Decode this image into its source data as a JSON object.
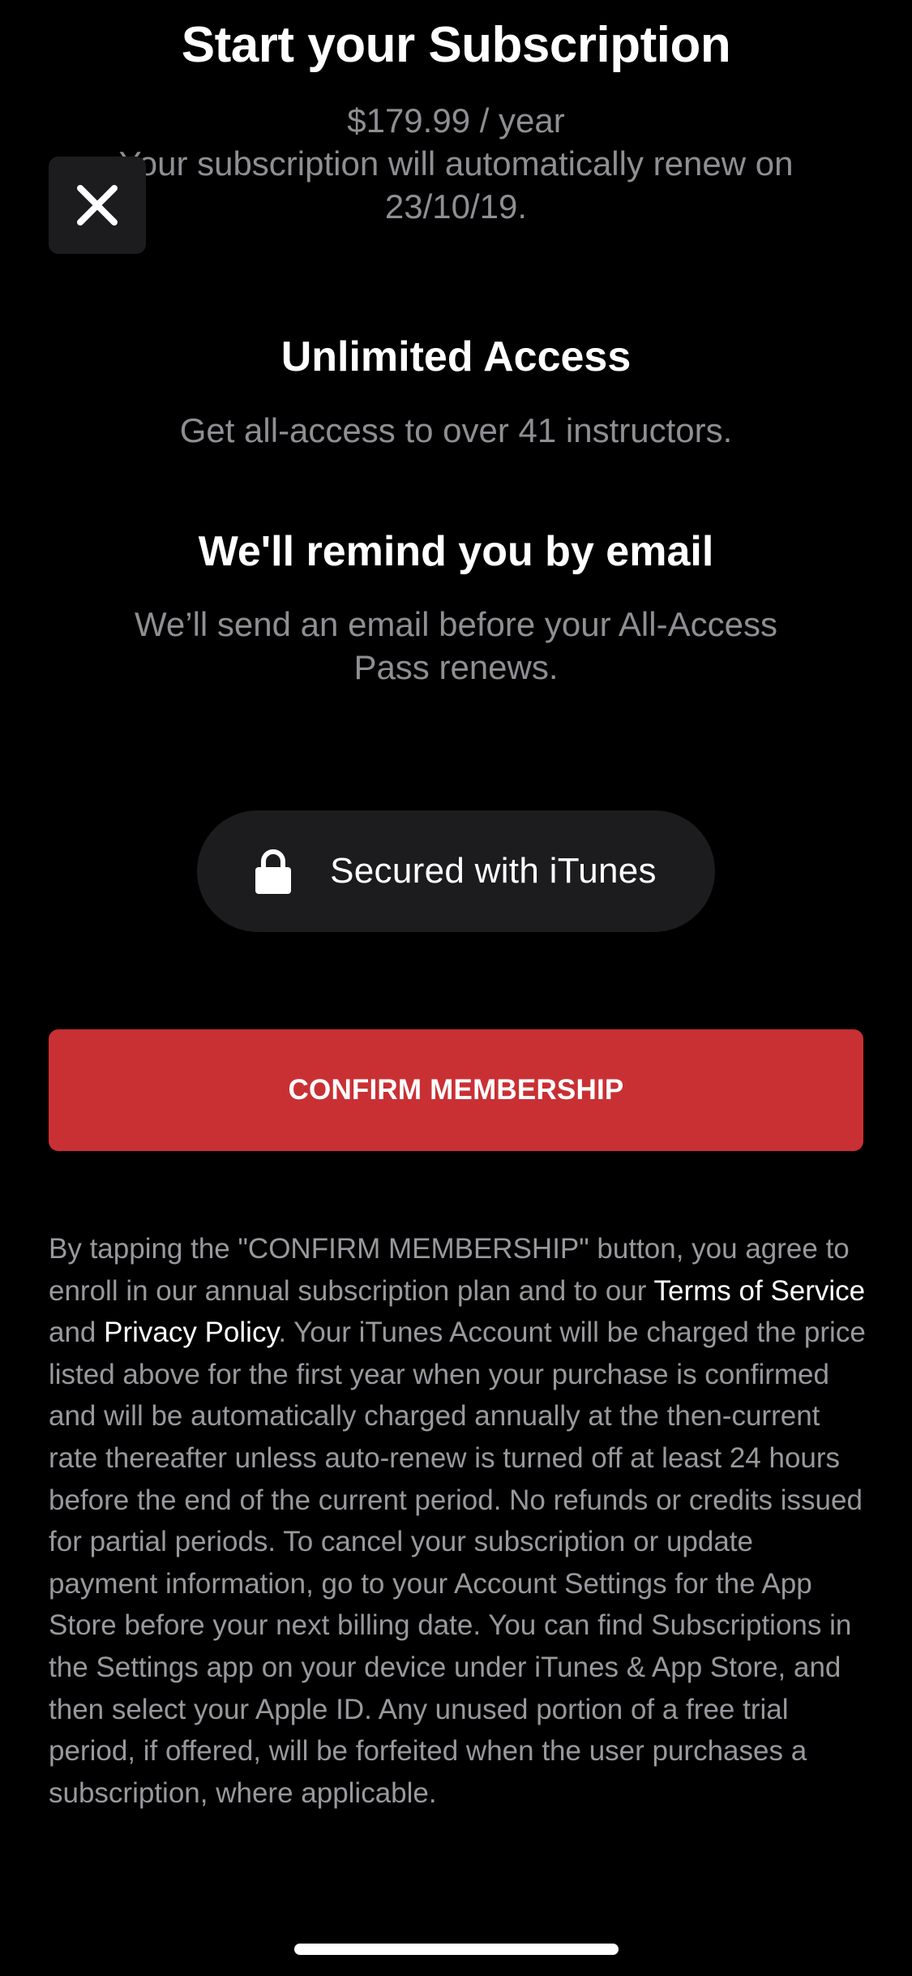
{
  "header": {
    "title": "Start your Subscription",
    "price": "$179.99 / year",
    "renewal_line1": "Your subscription will automatically renew on",
    "renewal_line2": "23/10/19."
  },
  "icons": {
    "close": "close-icon",
    "lock": "lock-icon"
  },
  "features": [
    {
      "heading": "Unlimited Access",
      "text": "Get all-access to over 41 instructors."
    },
    {
      "heading": "We'll remind you by email",
      "text_line1": "We’ll send an email before your All-Access",
      "text_line2": "Pass renews."
    }
  ],
  "secured": {
    "label": "Secured with iTunes"
  },
  "confirm": {
    "label": "CONFIRM MEMBERSHIP"
  },
  "legal": {
    "part1": "By tapping the \"CONFIRM MEMBERSHIP\" button, you agree to enroll in our annual subscription plan and to our ",
    "terms_link": "Terms of Service",
    "and": " and ",
    "privacy_link": "Privacy Policy",
    "part2": ". Your iTunes Account will be charged the price listed above for the first year when your purchase is confirmed and will be automatically charged annually at the then-current rate thereafter unless auto-renew is turned off at least 24 hours before the end of the current period. No refunds or credits issued for partial periods. To cancel your subscription or update payment information, go to your Account Settings for the App Store before your next billing date. You can find Subscriptions in the Settings app on your device under iTunes & App Store, and then select your Apple ID. Any unused portion of a free trial period, if offered, will be forfeited when the user purchases a subscription, where applicable."
  },
  "colors": {
    "background": "#000000",
    "accent_red": "#c93034",
    "panel": "#1c1c1e",
    "muted_text": "#8e8e93"
  }
}
